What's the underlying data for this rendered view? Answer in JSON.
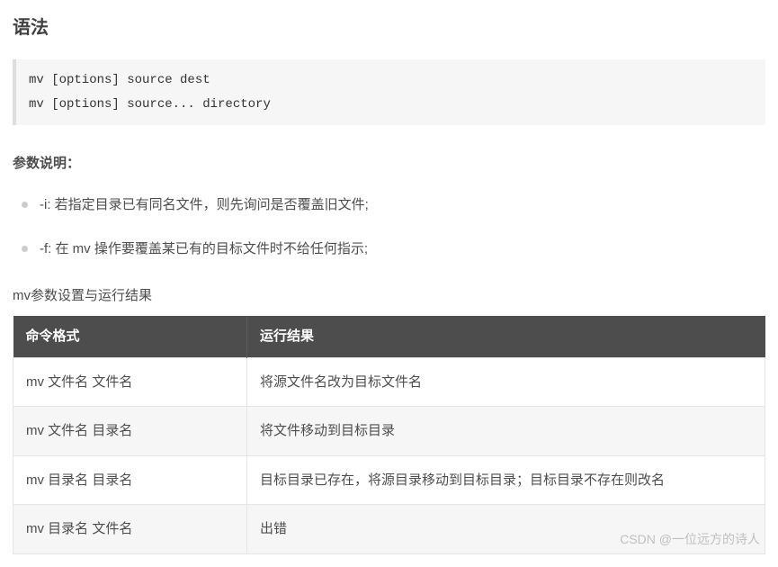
{
  "heading": "语法",
  "code_lines": [
    "mv [options] source dest",
    "mv [options] source... directory"
  ],
  "params_label": "参数说明：",
  "params": [
    "-i: 若指定目录已有同名文件，则先询问是否覆盖旧文件;",
    "-f: 在 mv 操作要覆盖某已有的目标文件时不给任何指示;"
  ],
  "table_caption": "mv参数设置与运行结果",
  "table": {
    "headers": [
      "命令格式",
      "运行结果"
    ],
    "rows": [
      [
        "mv 文件名 文件名",
        "将源文件名改为目标文件名"
      ],
      [
        "mv 文件名 目录名",
        "将文件移动到目标目录"
      ],
      [
        "mv 目录名 目录名",
        "目标目录已存在，将源目录移动到目标目录；目标目录不存在则改名"
      ],
      [
        "mv 目录名 文件名",
        "出错"
      ]
    ]
  },
  "watermark": "CSDN @一位远方的诗人"
}
